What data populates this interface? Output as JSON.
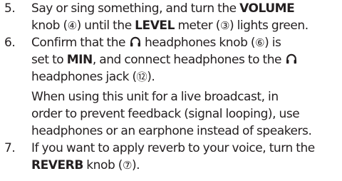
{
  "steps": [
    {
      "number": "5.",
      "l1_a": "Say or sing something, and turn the ",
      "l1_b": "VOLUME",
      "l2_a": "knob (",
      "l2_ref1": "④",
      "l2_b": ") until the ",
      "l2_c": "LEVEL",
      "l2_d": " meter (",
      "l2_ref2": "③",
      "l2_e": ") lights green."
    },
    {
      "number": "6.",
      "l1_a": "Confirm that the ",
      "l1_b": " headphones knob (",
      "l1_ref": "⑥",
      "l1_c": ") is",
      "l2_a": "set to ",
      "l2_b": "MIN",
      "l2_c": ", and connect headphones to the ",
      "l3_a": "headphones jack (",
      "l3_ref": "⑫",
      "l3_b": ").",
      "note_l1": "When using this unit for a live broadcast, in",
      "note_l2": "order to prevent feedback (signal looping), use",
      "note_l3": "headphones or an earphone instead of speakers."
    },
    {
      "number": "7.",
      "l1": "If you want to apply reverb to your voice, turn the",
      "l2_a": "REVERB",
      "l2_b": " knob (",
      "l2_ref": "⑦",
      "l2_c": ")."
    }
  ],
  "icons": {
    "headphones": "headphones-icon"
  },
  "colors": {
    "text": "#231f20"
  }
}
